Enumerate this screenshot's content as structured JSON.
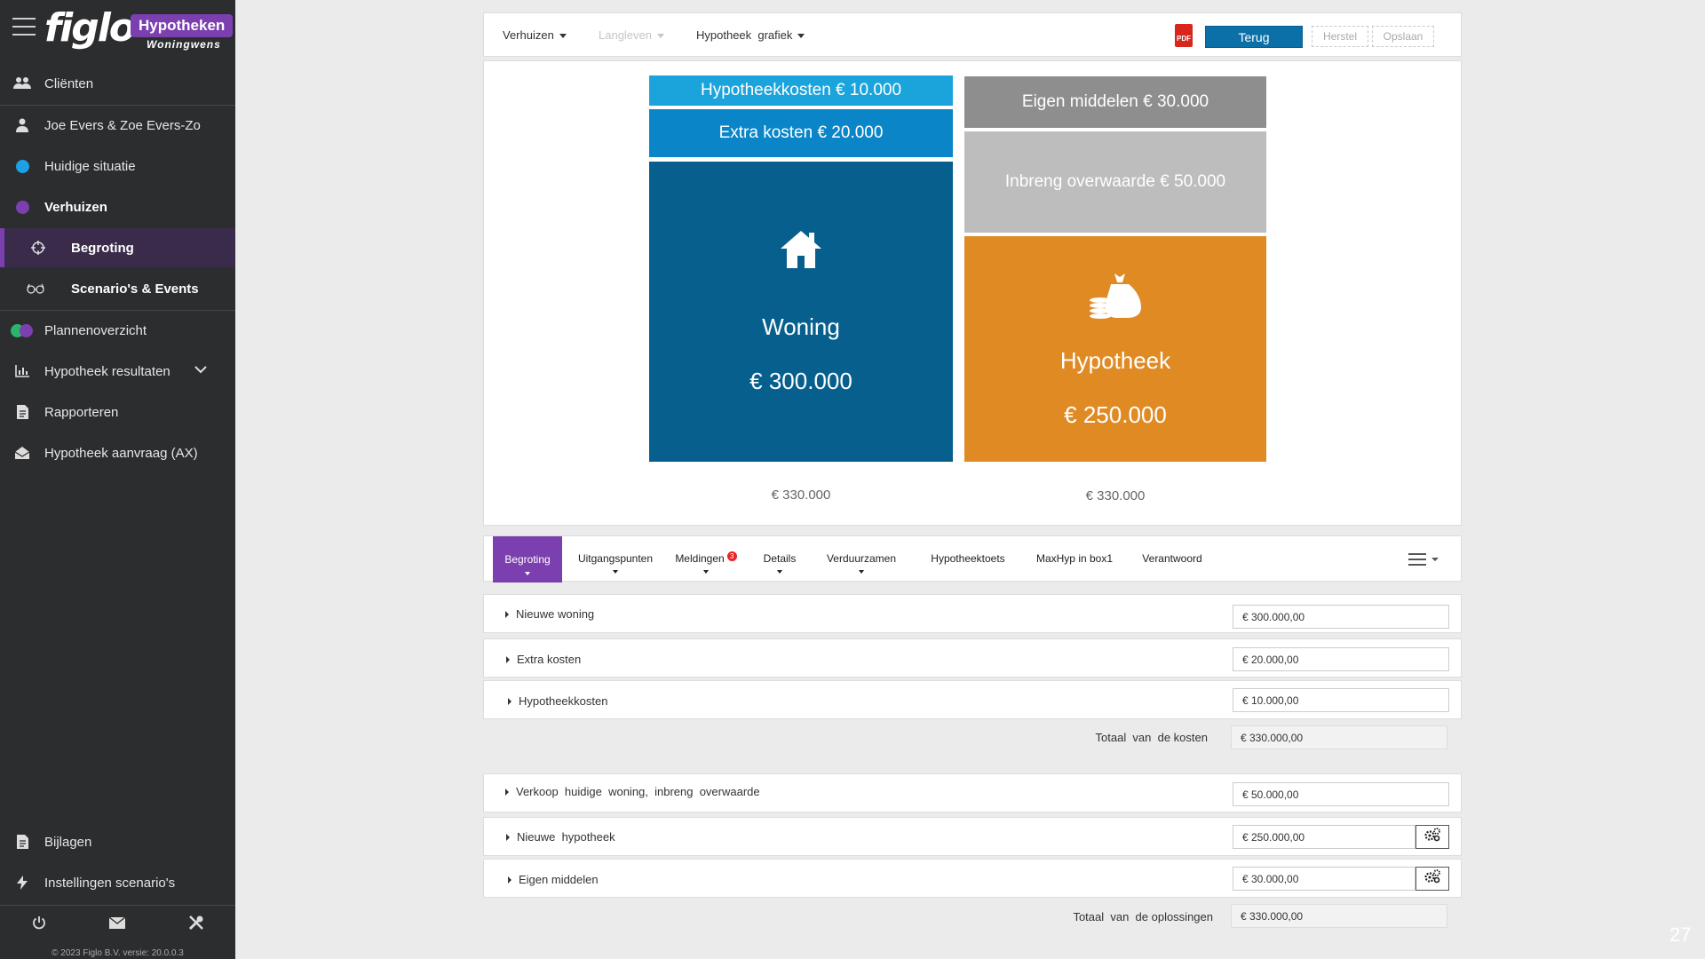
{
  "brand": {
    "logo": "figlo",
    "badge": "Hypotheken",
    "sub": "Woningwens"
  },
  "sidebar": {
    "items": [
      {
        "label": "Cliënten"
      },
      {
        "label": "Joe Evers & Zoe Evers-Zo"
      },
      {
        "label": "Huidige situatie"
      },
      {
        "label": "Verhuizen"
      },
      {
        "label": "Begroting"
      },
      {
        "label": "Scenario's & Events"
      },
      {
        "label": "Plannenoverzicht"
      },
      {
        "label": "Hypotheek resultaten"
      },
      {
        "label": "Rapporteren"
      },
      {
        "label": "Hypotheek aanvraag (AX)"
      },
      {
        "label": "Bijlagen"
      },
      {
        "label": "Instellingen scenario's"
      }
    ],
    "copyright": "© 2023 Figlo B.V. versie: 20.0.0.3"
  },
  "colors": {
    "sidebar_bg": "#2c2d2f",
    "accent_purple": "#7b3fb0",
    "dot_blue": "#1ea0e6",
    "dot_purple": "#7b3fb0",
    "dot_green": "#2db36c",
    "primary_button": "#0b6fa8"
  },
  "toolbar": {
    "dropdowns": [
      "Verhuizen",
      "Langleven",
      "Hypotheek  grafiek"
    ],
    "pdf_label": "PDF",
    "terug": "Terug",
    "herstel": "Herstel",
    "opslaan": "Opslaan"
  },
  "chart": {
    "left_blocks": [
      {
        "label": "Hypotheekkosten € 10.000"
      },
      {
        "label": "Extra kosten € 20.000"
      },
      {
        "title": "Woning",
        "amount": "€ 300.000"
      }
    ],
    "right_blocks": [
      {
        "label": "Eigen middelen € 30.000"
      },
      {
        "label": "Inbreng overwaarde € 50.000"
      },
      {
        "title": "Hypotheek",
        "amount": "€ 250.000"
      }
    ],
    "left_total": "€ 330.000",
    "right_total": "€ 330.000",
    "colors": {
      "hypotheekkosten": "#1ba4dc",
      "extra_kosten": "#0a86c8",
      "woning": "#075f8e",
      "eigen_middelen": "#8e8e8e",
      "overwaarde": "#bdbdbd",
      "hypotheek": "#e08a24"
    }
  },
  "tabs": [
    "Begroting",
    "Uitgangspunten",
    "Meldingen",
    "Details",
    "Verduurzamen",
    "Hypotheektoets",
    "MaxHyp in box1",
    "Verantwoord"
  ],
  "meldingen_count": "3",
  "costs": {
    "rows": [
      {
        "label": "Nieuwe woning",
        "value": "€ 300.000,00"
      },
      {
        "label": "Extra kosten",
        "value": "€ 20.000,00"
      },
      {
        "label": "Hypotheekkosten",
        "value": "€ 10.000,00"
      }
    ],
    "total_label": "Totaal  van  de kosten",
    "total_value": "€ 330.000,00"
  },
  "solutions": {
    "rows": [
      {
        "label": "Verkoop  huidige  woning,  inbreng  overwaarde",
        "value": "€ 50.000,00"
      },
      {
        "label": "Nieuwe  hypotheek",
        "value": "€ 250.000,00"
      },
      {
        "label": "Eigen middelen",
        "value": "€ 30.000,00"
      }
    ],
    "total_label": "Totaal  van  de oplossingen",
    "total_value": "€ 330.000,00"
  },
  "page_number": "27"
}
